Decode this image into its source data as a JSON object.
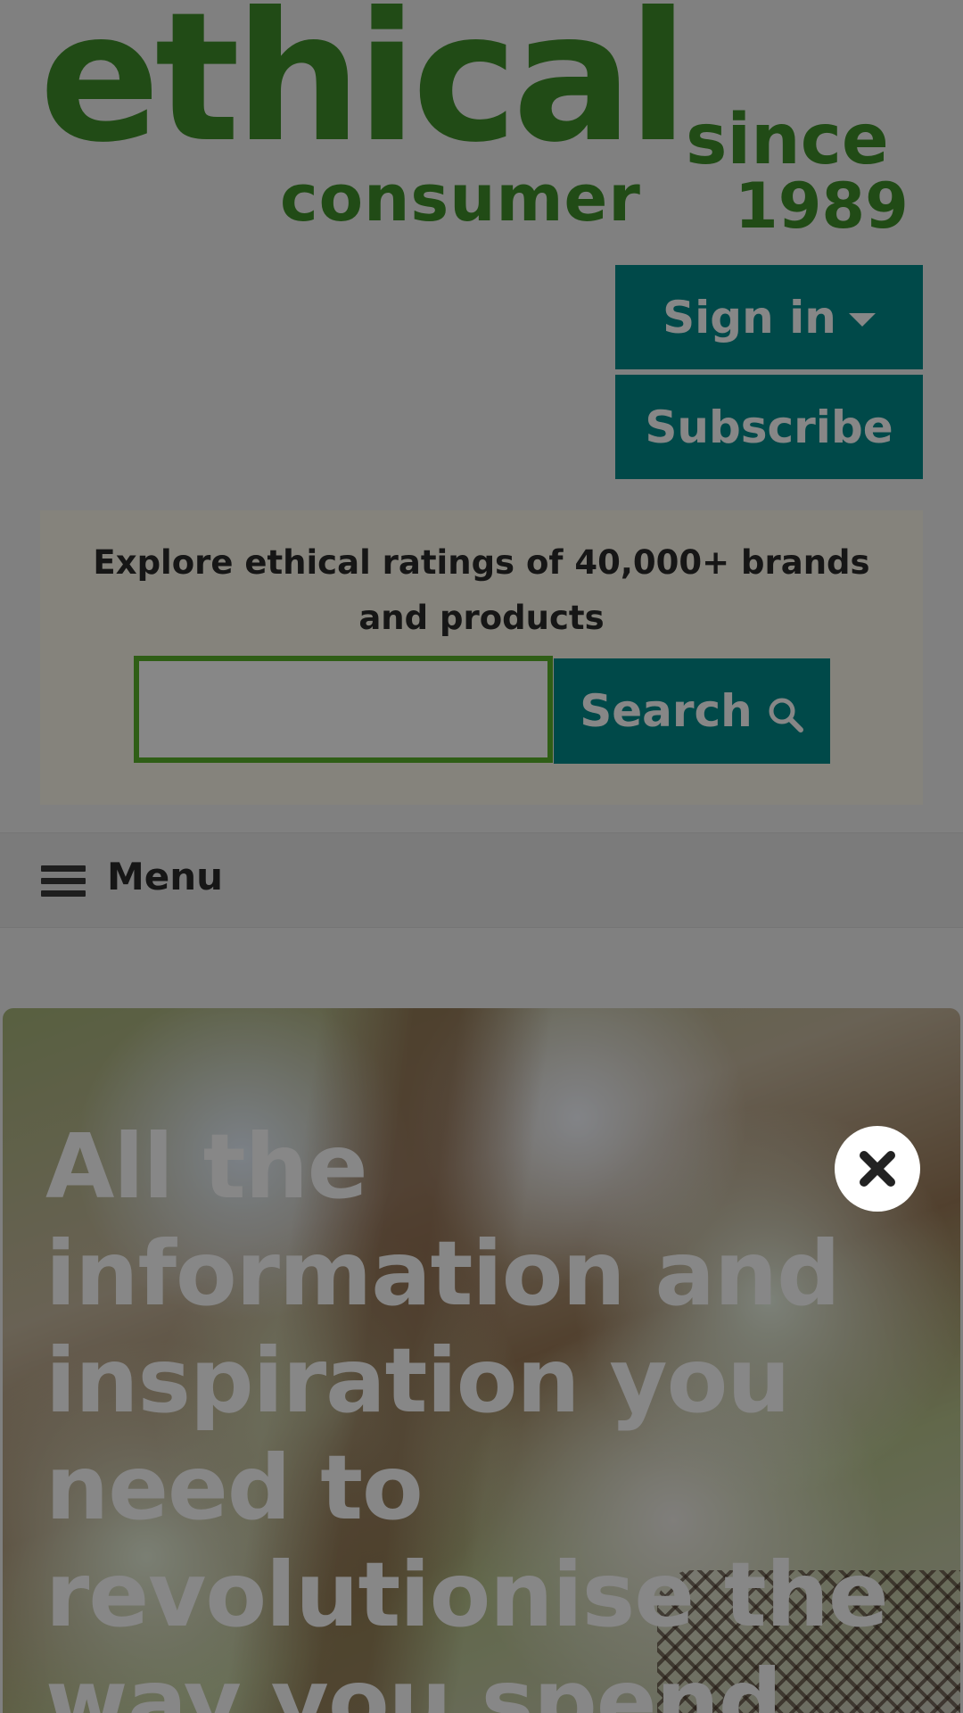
{
  "logo": {
    "word_main": "ethical",
    "word_sub": "consumer",
    "since": "since",
    "year": "1989"
  },
  "header": {
    "signin_label": "Sign in",
    "subscribe_label": "Subscribe"
  },
  "search": {
    "title": "Explore ethical ratings of 40,000+ brands and products",
    "placeholder": "",
    "button_label": "Search"
  },
  "menu": {
    "label": "Menu"
  },
  "hero": {
    "headline": "All the information and inspiration you need to revolutionise the way you spend."
  },
  "icons": {
    "signin_caret": "caret-down-icon",
    "search": "search-icon",
    "menu": "hamburger-icon",
    "close": "close-icon"
  },
  "colors": {
    "brand_green": "#3f8f2a",
    "button_teal": "#008b8b",
    "input_border": "#5ab12a",
    "panel_bg": "#fbf7ea",
    "menu_bg": "#e9e9e9",
    "overlay": "rgba(0,0,0,0.47)"
  }
}
